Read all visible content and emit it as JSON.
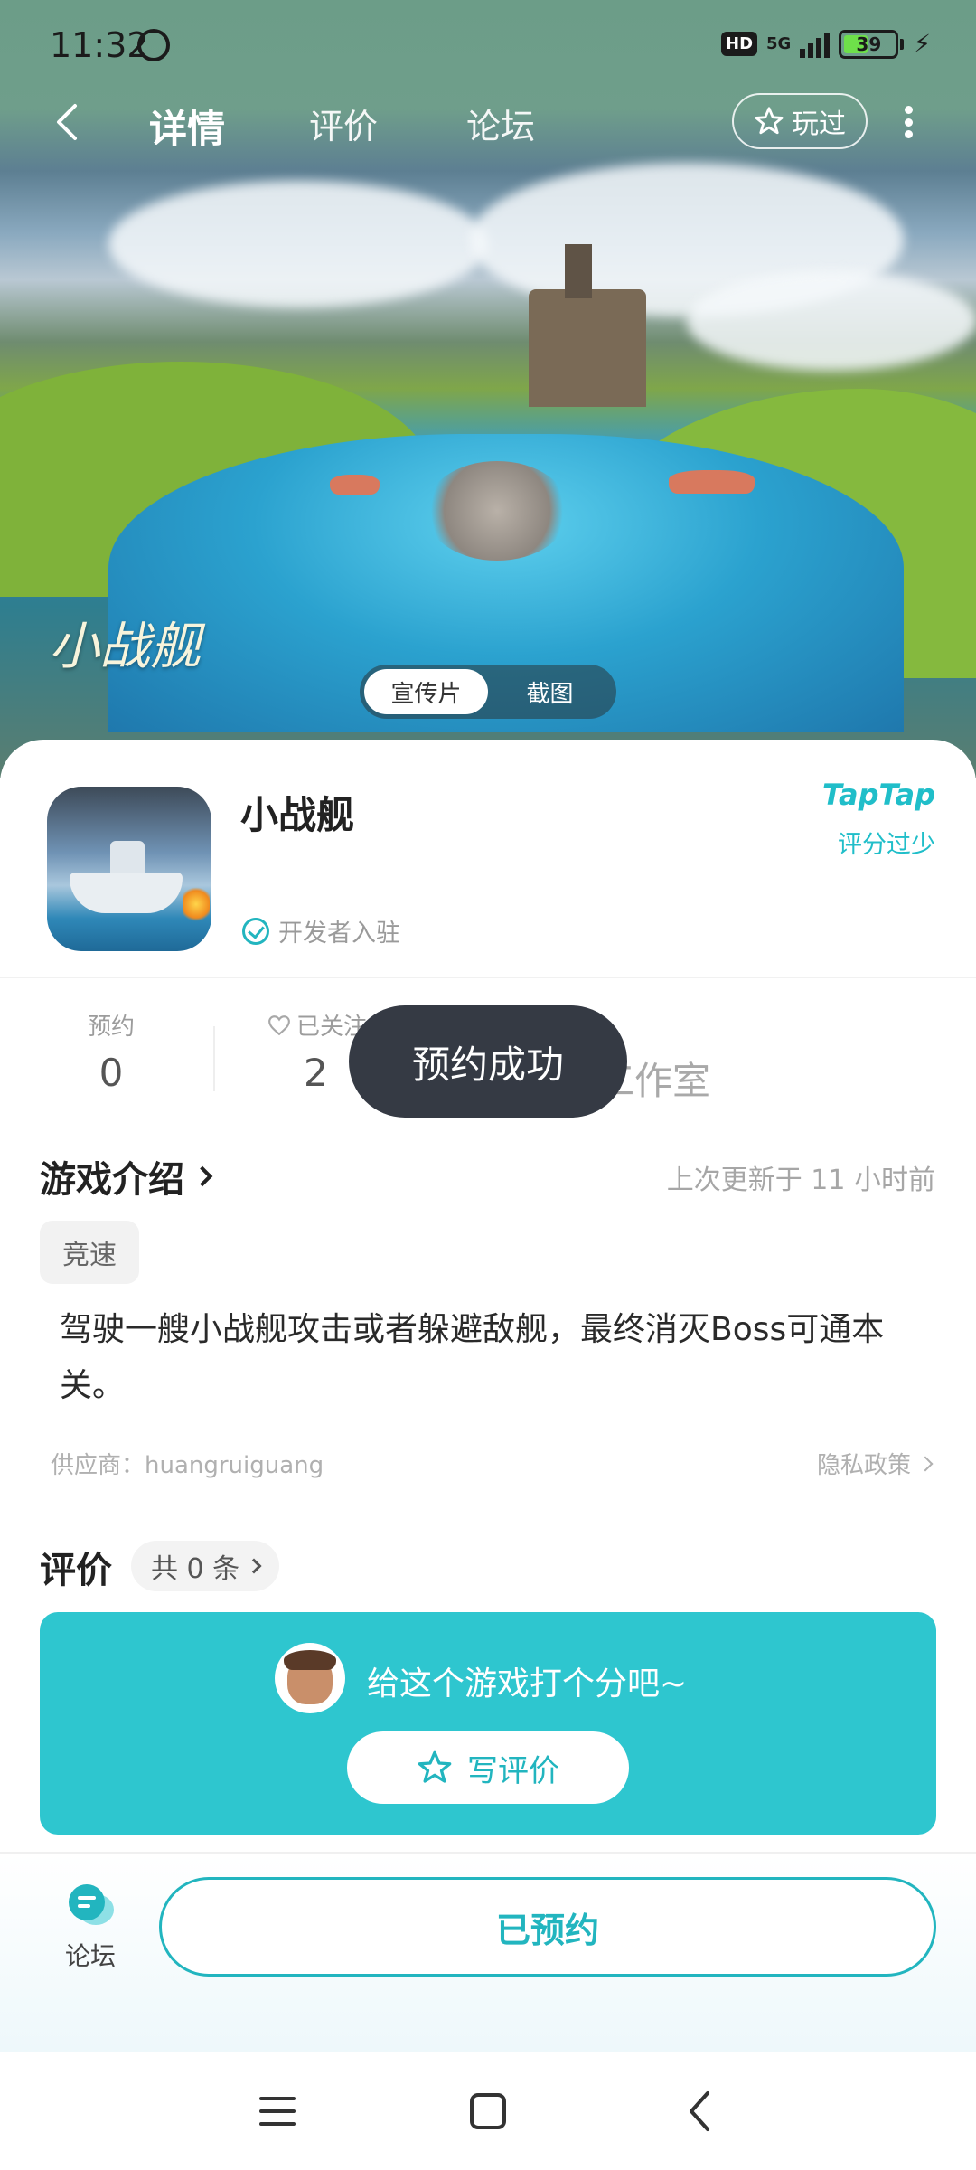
{
  "status_bar": {
    "time": "11:32",
    "hd_label": "HD",
    "network_label": "5G",
    "battery_level": "39"
  },
  "nav": {
    "tabs": [
      "详情",
      "评价",
      "论坛"
    ],
    "active_tab_index": 0,
    "played_label": "玩过"
  },
  "hero": {
    "title": "小战舰",
    "media_toggle": [
      "宣传片",
      "截图"
    ],
    "active_media_index": 0
  },
  "app": {
    "name": "小战舰",
    "developer_badge": "开发者入驻",
    "brand": "TapTap",
    "rating_note": "评分过少"
  },
  "stats": {
    "reservations_label": "预约",
    "reservations_value": "0",
    "followers_label": "已关注",
    "followers_value": "2",
    "studio_name": "工作室"
  },
  "toast": {
    "message": "预约成功"
  },
  "intro": {
    "title": "游戏介绍",
    "updated": "上次更新于 11 小时前",
    "tag": "竞速",
    "description": "驾驶一艘小战舰攻击或者躲避敌舰，最终消灭Boss可通本关。",
    "supplier": "供应商：huangruiguang",
    "privacy": "隐私政策"
  },
  "reviews": {
    "title": "评价",
    "count_label": "共 0 条",
    "prompt": "给这个游戏打个分吧~",
    "write_label": "写评价"
  },
  "bottom_bar": {
    "forum_label": "论坛",
    "reserved_label": "已预约"
  },
  "colors": {
    "accent": "#22b5bf",
    "rate_box": "#2ec6cf",
    "toast_bg": "#353a44",
    "hero_bg": "#6c9d88"
  },
  "icons": [
    "alarm-icon",
    "back-icon",
    "star-outline-icon",
    "more-icon",
    "check-circle-icon",
    "heart-icon",
    "chevron-right-icon",
    "star-icon",
    "forum-chat-icon",
    "menu-icon",
    "home-square-icon",
    "back-triangle-icon"
  ]
}
